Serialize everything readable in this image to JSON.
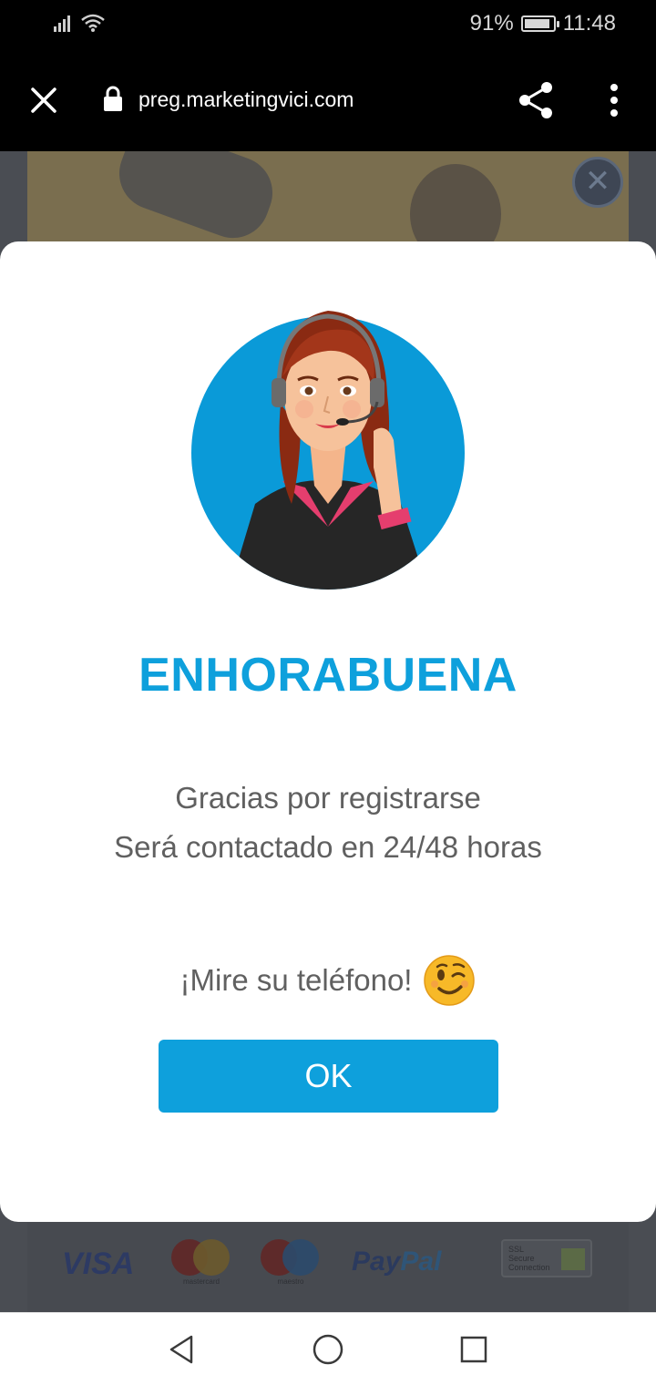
{
  "status_bar": {
    "battery_percent": "91%",
    "battery_level": 0.91,
    "time": "11:48",
    "icons": [
      "signal-icon",
      "wifi-icon",
      "battery-icon"
    ]
  },
  "browser": {
    "url": "preg.marketingvici.com",
    "icons": [
      "close-icon",
      "lock-icon",
      "share-icon",
      "more-vert-icon"
    ]
  },
  "background_page": {
    "payment_logos": {
      "visa": "VISA",
      "mastercard": "mastercard",
      "maestro": "maestro",
      "paypal_a": "Pay",
      "paypal_b": "Pal",
      "ssl_line1": "SSL",
      "ssl_line2": "Secure",
      "ssl_line3": "Connection"
    }
  },
  "modal": {
    "title": "ENHORABUENA",
    "message_line1": "Gracias por registrarse",
    "message_line2": "Será contactado en 24/48 horas",
    "phone_text": "¡Mire su teléfono!",
    "emoji": "winking-face-emoji",
    "ok_label": "OK"
  },
  "colors": {
    "accent": "#0ea0dc",
    "text_gray": "#606060",
    "overlay": "#4a4d53"
  },
  "nav_bar": {
    "icons": [
      "back-icon",
      "home-icon",
      "recent-apps-icon"
    ]
  }
}
